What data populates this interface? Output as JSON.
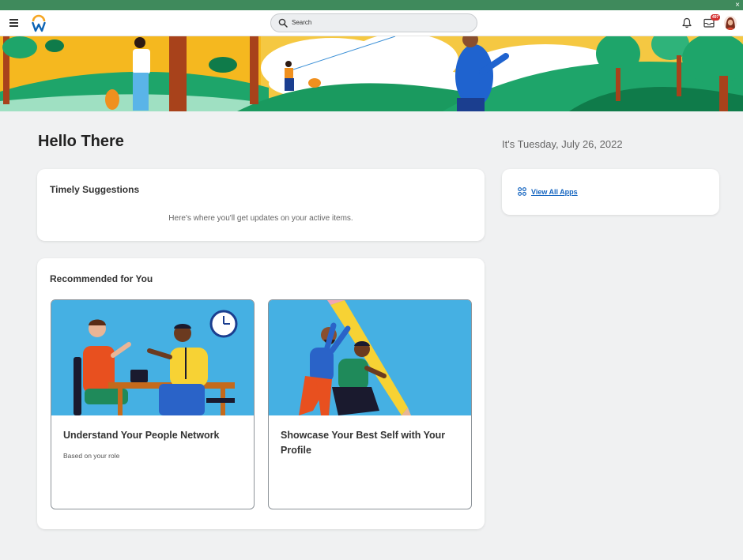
{
  "window": {
    "close_glyph": "×"
  },
  "header": {
    "menu_icon": "hamburger-menu-icon",
    "logo_icon": "workday-logo",
    "search": {
      "placeholder": "Search"
    },
    "notifications_icon": "bell-icon",
    "inbox_icon": "inbox-icon",
    "inbox_badge": "497",
    "avatar": "user-avatar"
  },
  "colors": {
    "os_bar": "#3f8a5c",
    "accent_link": "#1565c0",
    "badge": "#d32f2f",
    "illustration_bg": "#45b0e3"
  },
  "main": {
    "greeting": "Hello There",
    "date": "It's Tuesday, July 26, 2022",
    "timely": {
      "title": "Timely Suggestions",
      "message": "Here's where you'll get updates on your active items."
    },
    "apps": {
      "icon": "grid-apps-icon",
      "label": "View All Apps"
    },
    "recommended": {
      "title": "Recommended for You",
      "items": [
        {
          "title": "Understand Your People Network",
          "subtitle": "Based on your role"
        },
        {
          "title": "Showcase Your Best Self with Your Profile",
          "subtitle": ""
        }
      ]
    }
  }
}
